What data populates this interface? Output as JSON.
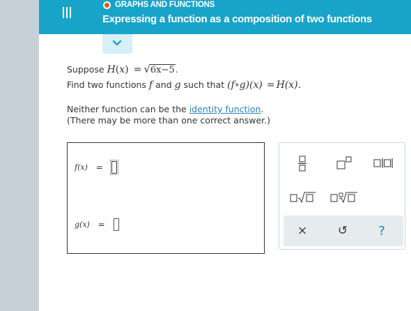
{
  "header": {
    "topic": "GRAPHS AND FUNCTIONS",
    "title": "Expressing a function as a composition of two functions",
    "status_color": "#e8541a",
    "accent_color": "#18a4c8"
  },
  "problem": {
    "suppose_label": "Suppose",
    "H": "H",
    "x": "x",
    "equals": "=",
    "radicand": "6x−5",
    "period": ".",
    "find_prefix": "Find two functions",
    "f": "f",
    "and": "and",
    "g": "g",
    "such_that": "such that",
    "composition": "(f∘g)(x)",
    "result": "H(x).",
    "neither_prefix": "Neither function can be the",
    "identity_link": "identity function",
    "neither_suffix": ".",
    "note": "(There may be more than one correct answer.)"
  },
  "answers": {
    "f_label": "f(x)",
    "g_label": "g(x)",
    "equals": "="
  },
  "keypad": {
    "fraction_icon": "fraction-icon",
    "exponent_icon": "exponent-icon",
    "absolute_icon": "absolute-value-icon",
    "sqrt_icon": "square-root-icon",
    "nthroot_icon": "nth-root-icon",
    "clear_glyph": "×",
    "undo_glyph": "↺",
    "help_glyph": "?"
  }
}
